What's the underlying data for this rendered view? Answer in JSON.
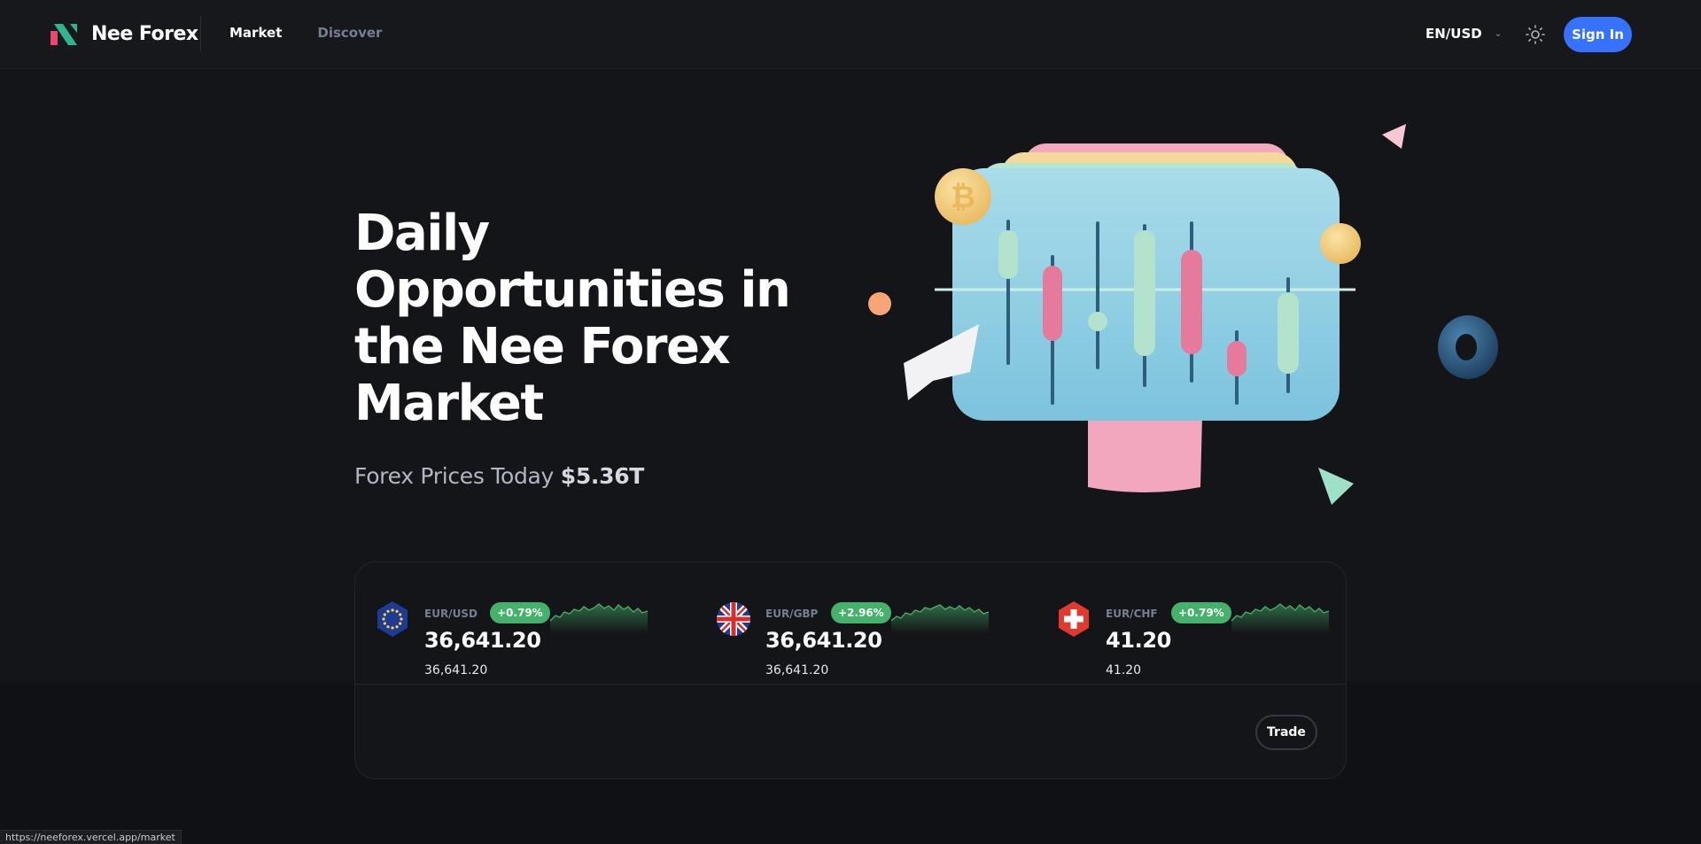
{
  "brand": {
    "name": "Nee Forex",
    "accent": "#3772ff",
    "green": "#45b26b",
    "logo_red": "#ef466f",
    "logo_green": "#2fb68e"
  },
  "nav": {
    "items": [
      {
        "label": "Market"
      },
      {
        "label": "Discover"
      }
    ]
  },
  "header": {
    "lang": "EN/USD",
    "signin_label": "Sign In"
  },
  "hero": {
    "title": "Daily Opportunities in the Nee Forex Market",
    "subtitle_prefix": "Forex Prices Today",
    "subtitle_value": "$5.36T"
  },
  "tickers": [
    {
      "pair": "EUR/USD",
      "change": "+0.79%",
      "price": "36,641.20",
      "sub_price": "36,641.20",
      "flag": "eu-flag-icon"
    },
    {
      "pair": "EUR/GBP",
      "change": "+2.96%",
      "price": "36,641.20",
      "sub_price": "36,641.20",
      "flag": "uk-flag-icon"
    },
    {
      "pair": "EUR/CHF",
      "change": "+0.79%",
      "price": "41.20",
      "sub_price": "41.20",
      "flag": "swiss-flag-icon"
    }
  ],
  "panel": {
    "trade_label": "Trade"
  },
  "status_bar": {
    "url": "https://neeforex.vercel.app/market"
  }
}
